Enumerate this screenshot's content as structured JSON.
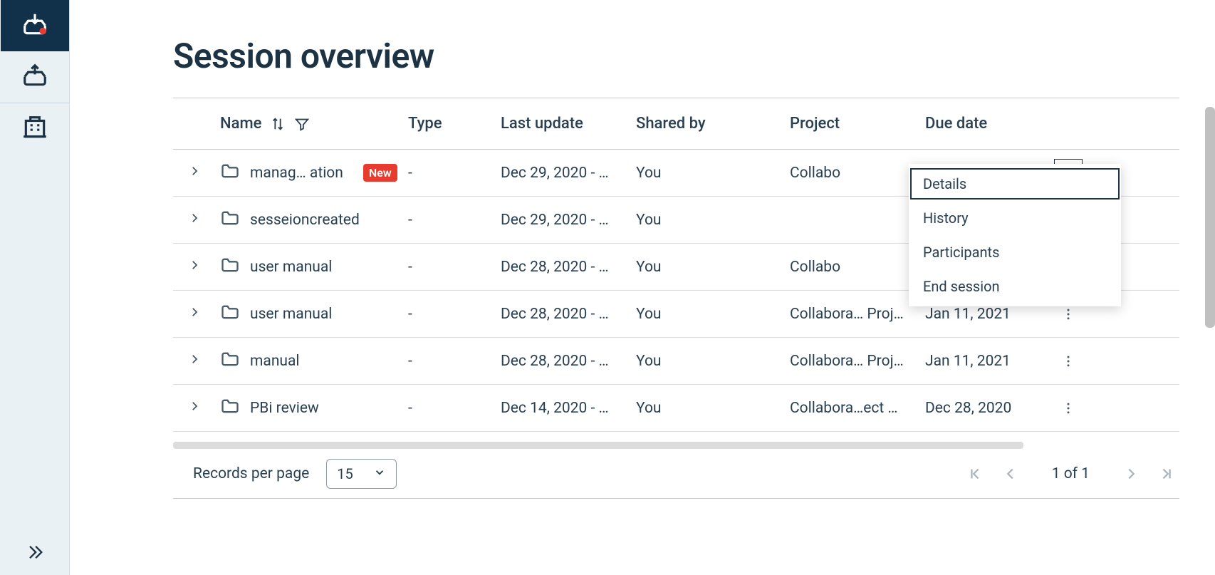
{
  "page": {
    "title": "Session overview"
  },
  "table": {
    "headers": {
      "name": "Name",
      "type": "Type",
      "last_update": "Last update",
      "shared_by": "Shared by",
      "project": "Project",
      "due_date": "Due date"
    },
    "rows": [
      {
        "name": "manag… ation",
        "badge": "New",
        "type": "-",
        "last_update": "Dec 29, 2020 - …",
        "shared_by": "You",
        "project": "Collabo",
        "due_date": ""
      },
      {
        "name": "sesseioncreated",
        "badge": "",
        "type": "-",
        "last_update": "Dec 29, 2020 - …",
        "shared_by": "You",
        "project": "",
        "due_date": ""
      },
      {
        "name": "user manual",
        "badge": "",
        "type": "-",
        "last_update": "Dec 28, 2020 - …",
        "shared_by": "You",
        "project": "Collabo",
        "due_date": ""
      },
      {
        "name": "user manual",
        "badge": "",
        "type": "-",
        "last_update": "Dec 28, 2020 - …",
        "shared_by": "You",
        "project": "Collabora… Proj…",
        "due_date": "Jan 11, 2021"
      },
      {
        "name": "manual",
        "badge": "",
        "type": "-",
        "last_update": "Dec 28, 2020 - …",
        "shared_by": "You",
        "project": "Collabora… Proj…",
        "due_date": "Jan 11, 2021"
      },
      {
        "name": "PBi review",
        "badge": "",
        "type": "-",
        "last_update": "Dec 14, 2020 - …",
        "shared_by": "You",
        "project": "Collabora…ect …",
        "due_date": "Dec 28, 2020"
      }
    ]
  },
  "dropdown": {
    "items": [
      "Details",
      "History",
      "Participants",
      "End session"
    ]
  },
  "pager": {
    "records_label": "Records per page",
    "records_value": "15",
    "info": "1 of 1"
  }
}
